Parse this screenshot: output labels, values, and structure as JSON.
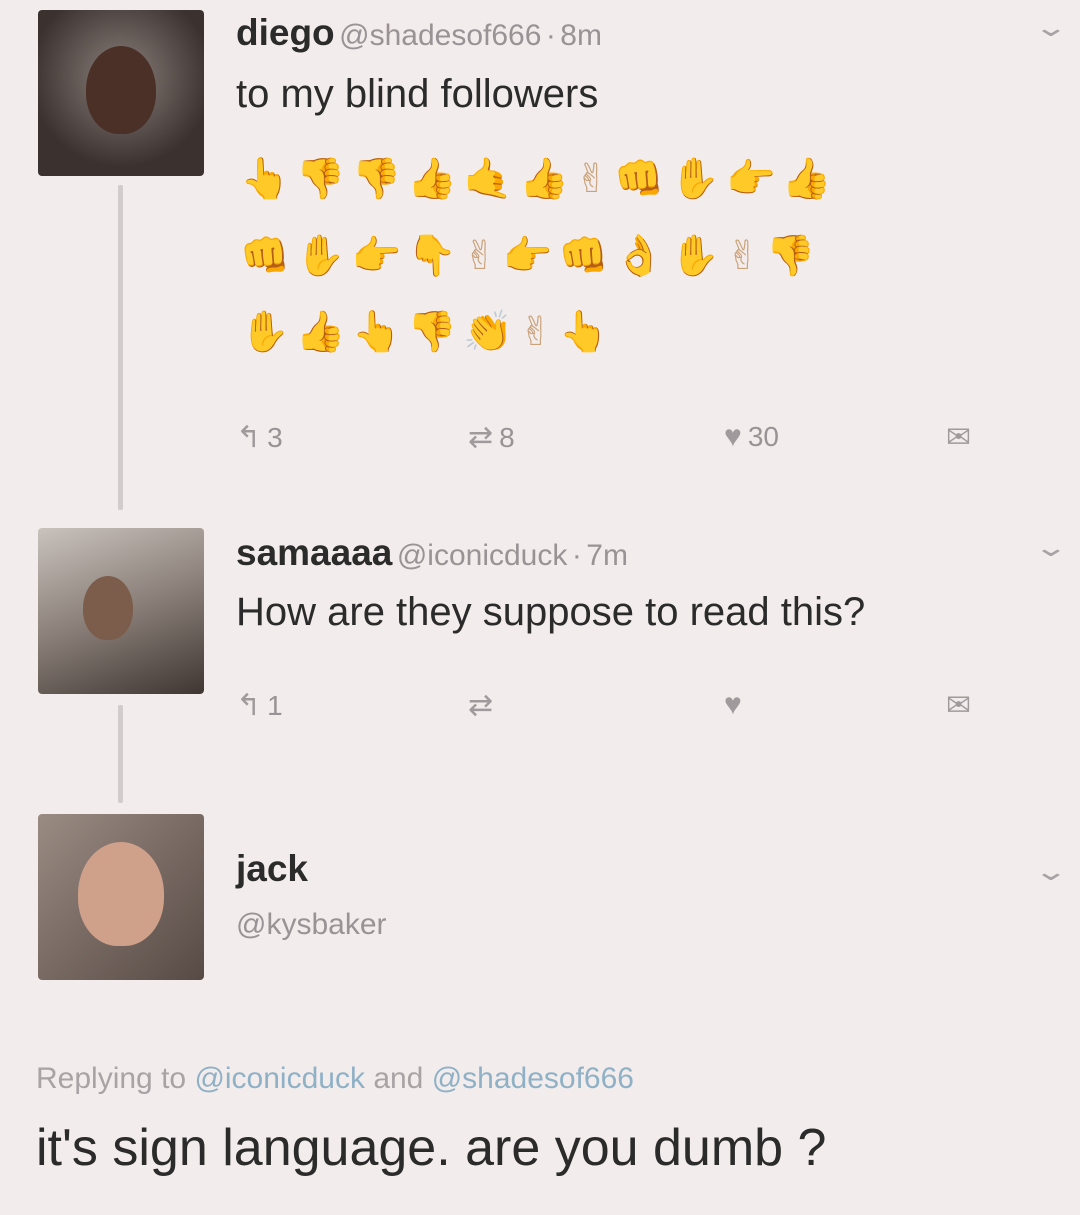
{
  "tweets": [
    {
      "name": "diego",
      "handle": "@shadesof666",
      "sep": "·",
      "time": "8m",
      "text": "to my blind followers",
      "emoji_rows": [
        "👆👎👎👍🤙👍✌👊✋👉👍",
        "👊✋👉👇✌👉👊👌✋✌👎",
        "✋👍👆👎👏✌👆"
      ],
      "replies": "3",
      "retweets": "8",
      "likes": "30"
    },
    {
      "name": "samaaaa",
      "handle": "@iconicduck",
      "sep": "·",
      "time": "7m",
      "text": "How are they suppose to read this?",
      "replies": "1",
      "retweets": "",
      "likes": ""
    },
    {
      "name": "jack",
      "handle": "@kysbaker",
      "replying_prefix": "Replying to",
      "replying_mention1": "@iconicduck",
      "replying_and": "and",
      "replying_mention2": "@shadesof666",
      "text": "it's sign language. are you dumb ?"
    }
  ],
  "icons": {
    "reply": "↰",
    "retweet": "⇄",
    "like": "♥",
    "dm": "✉",
    "chevron": "⌄"
  },
  "colors": {
    "background": "#f3ecec",
    "mention": "#8fb1c6",
    "muted": "#9a9396"
  }
}
